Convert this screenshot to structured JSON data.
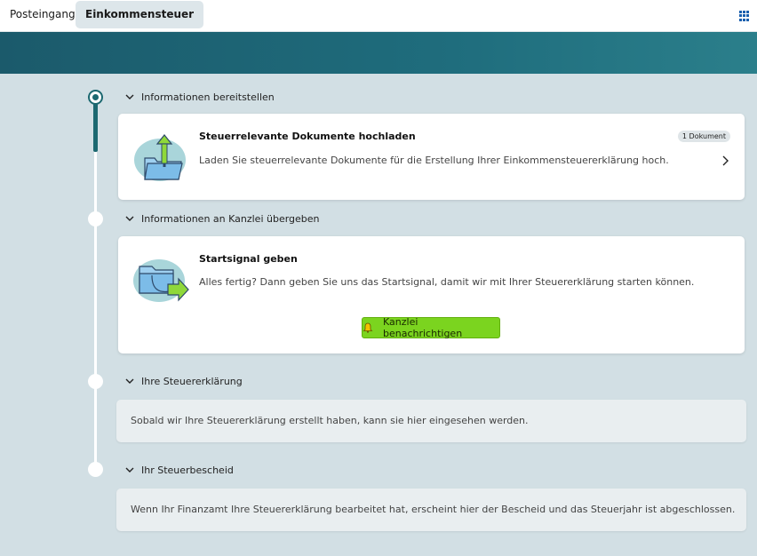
{
  "topbar": {
    "tabs": [
      {
        "label": "Posteingang"
      },
      {
        "label": "Einkommensteuer"
      }
    ],
    "apps_icon": "grid-icon"
  },
  "sections": [
    {
      "heading": "Informationen bereitstellen",
      "card": {
        "title": "Steuerrelevante Dokumente hochladen",
        "description": "Laden Sie steuerrelevante Dokumente für die Erstellung Ihrer Einkommensteuererklärung hoch.",
        "badge": "1 Dokument",
        "icon": "folder-upload-icon"
      }
    },
    {
      "heading": "Informationen an Kanzlei übergeben",
      "card": {
        "title": "Startsignal geben",
        "description": "Alles fertig? Dann geben Sie uns das Startsignal, damit wir mit Ihrer Steuererklärung starten können.",
        "button": "Kanzlei benachrichtigen",
        "icon": "folder-send-icon"
      }
    },
    {
      "heading": "Ihre Steuererklärung",
      "info": "Sobald wir Ihre Steuererklärung erstellt haben, kann sie hier eingesehen werden."
    },
    {
      "heading": "Ihr Steuerbescheid",
      "info": "Wenn Ihr Finanzamt Ihre Steuererklärung bearbeitet hat, erscheint hier der Bescheid und das Steuerjahr ist abgeschlossen."
    }
  ],
  "colors": {
    "accent": "#1c6870",
    "background": "#d2dfe4",
    "button": "#7bd41f",
    "link": "#1a5fae"
  }
}
